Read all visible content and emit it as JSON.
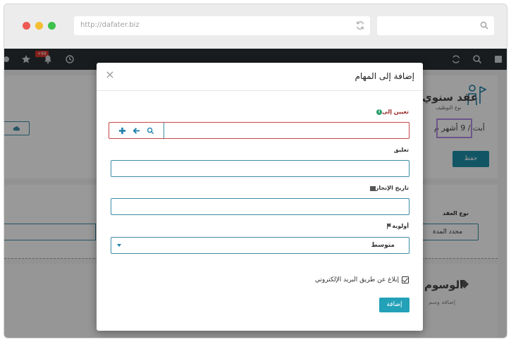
{
  "browser": {
    "url": "http://dafater.biz"
  },
  "app_bg": {
    "notification_badge": "+99",
    "title": "عقد سنوي",
    "subtitle": "نوع التوظيف",
    "duration": "أبت / 9 أشهر م",
    "save_label": "حفظ",
    "contract_type_label": "نوع العقد",
    "contract_type_value": "محدد المدة",
    "tags_title": "الوسوم",
    "tags_subtitle": "إضافة وسم"
  },
  "modal": {
    "title": "إضافة إلى المهام",
    "close_symbol": "×",
    "assign_label": "تعيين إلى",
    "info_symbol": "i",
    "comment_label": "تعليق",
    "comment_value": "",
    "due_date_label": "تاريخ الإنجاز",
    "due_date_value": "",
    "priority_label": "أولوية",
    "priority_value": "متوسط",
    "notify_label": "إبلاغ عن طريق البريد الإلكتروني",
    "notify_checked": true,
    "add_label": "إضافة"
  },
  "colors": {
    "accent": "#22a1b8",
    "error_border": "#c84646",
    "field_border": "#3d8ca6",
    "topbar": "#2b2f33",
    "info_green": "#2a9d6a",
    "highlight": "#b58ee8"
  }
}
